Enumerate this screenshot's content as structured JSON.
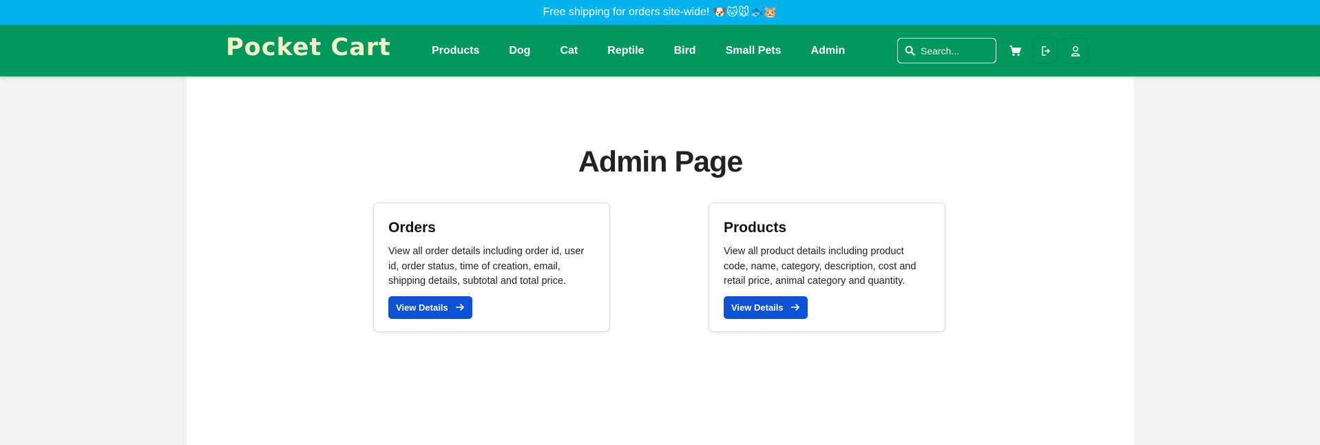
{
  "announcement": {
    "text": "Free shipping for orders site-wide!",
    "emoji": "🐶🐱🐭🐟🐹"
  },
  "brand": {
    "logo": "Pocket Cart"
  },
  "nav": {
    "links": [
      "Products",
      "Dog",
      "Cat",
      "Reptile",
      "Bird",
      "Small Pets",
      "Admin"
    ]
  },
  "search": {
    "placeholder": "Search..."
  },
  "header_icons": [
    "cart-icon",
    "login-icon",
    "user-icon"
  ],
  "page": {
    "title": "Admin Page"
  },
  "cards": [
    {
      "title": "Orders",
      "description": "View all order details including order id, user id, order status, time of creation, email, shipping details, subtotal and total price.",
      "button": "View Details"
    },
    {
      "title": "Products",
      "description": "View all product details including product code, name, category, description, cost and retail price, animal category and quantity.",
      "button": "View Details"
    }
  ],
  "colors": {
    "announce_bg": "#03b3ee",
    "nav_bg": "#02985d",
    "accent": "#0b52d4"
  }
}
